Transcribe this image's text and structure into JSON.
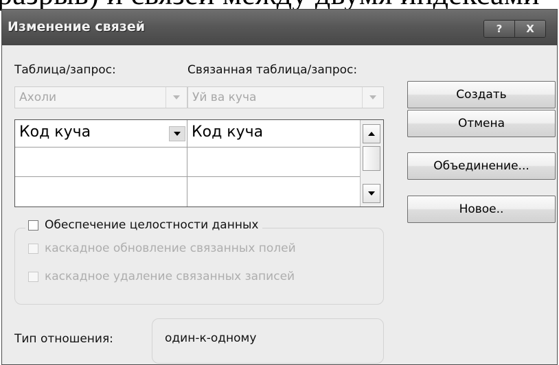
{
  "background_text": "разрыв) и связей между двумя индексами",
  "window": {
    "title": "Изменение связей",
    "help_label": "?",
    "close_label": "X"
  },
  "labels": {
    "table_query": "Таблица/запрос:",
    "related_table_query": "Связанная таблица/запрос:"
  },
  "combos": {
    "table": {
      "value": "Ахоли"
    },
    "related_table": {
      "value": "Уй ва куча"
    }
  },
  "grid": {
    "rows": [
      {
        "left": "Код куча",
        "right": "Код куча"
      },
      {
        "left": "",
        "right": ""
      },
      {
        "left": "",
        "right": ""
      }
    ]
  },
  "buttons": {
    "create": "Создать",
    "cancel": "Отмена",
    "join": "Объединение...",
    "new": "Новое.."
  },
  "integrity": {
    "enforce_label": "Обеспечение целостности данных",
    "enforce_checked": false,
    "cascade_update_label": "каскадное обновление связанных полей",
    "cascade_update_checked": false,
    "cascade_delete_label": "каскадное удаление связанных записей",
    "cascade_delete_checked": false
  },
  "relationship": {
    "label": "Тип отношения:",
    "value": "один-к-одному"
  },
  "icons": {
    "combo_arrow": "chevron-down-icon",
    "scroll_up": "scroll-up-arrow-icon",
    "scroll_down": "scroll-down-arrow-icon"
  }
}
